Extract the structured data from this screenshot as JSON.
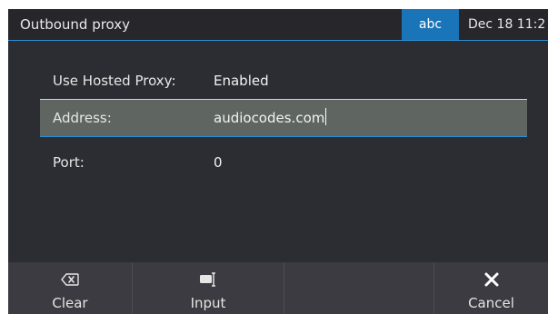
{
  "header": {
    "title": "Outbound proxy",
    "input_mode": "abc",
    "clock": "Dec 18 11:2"
  },
  "fields": [
    {
      "label": "Use Hosted Proxy:",
      "value": "Enabled"
    },
    {
      "label": "Address:",
      "value": "audiocodes.com"
    },
    {
      "label": "Port:",
      "value": "0"
    }
  ],
  "softkeys": [
    {
      "label": "Clear",
      "icon": "backspace-icon"
    },
    {
      "label": "Input",
      "icon": "input-mode-icon"
    },
    {
      "label": "",
      "icon": ""
    },
    {
      "label": "Cancel",
      "icon": "close-icon"
    }
  ],
  "colors": {
    "accent": "#2b8fd3",
    "badge": "#1a74b8",
    "background": "#2c2c33",
    "selected_row": "#5f6662",
    "softkey_bar": "#3b3b41"
  }
}
